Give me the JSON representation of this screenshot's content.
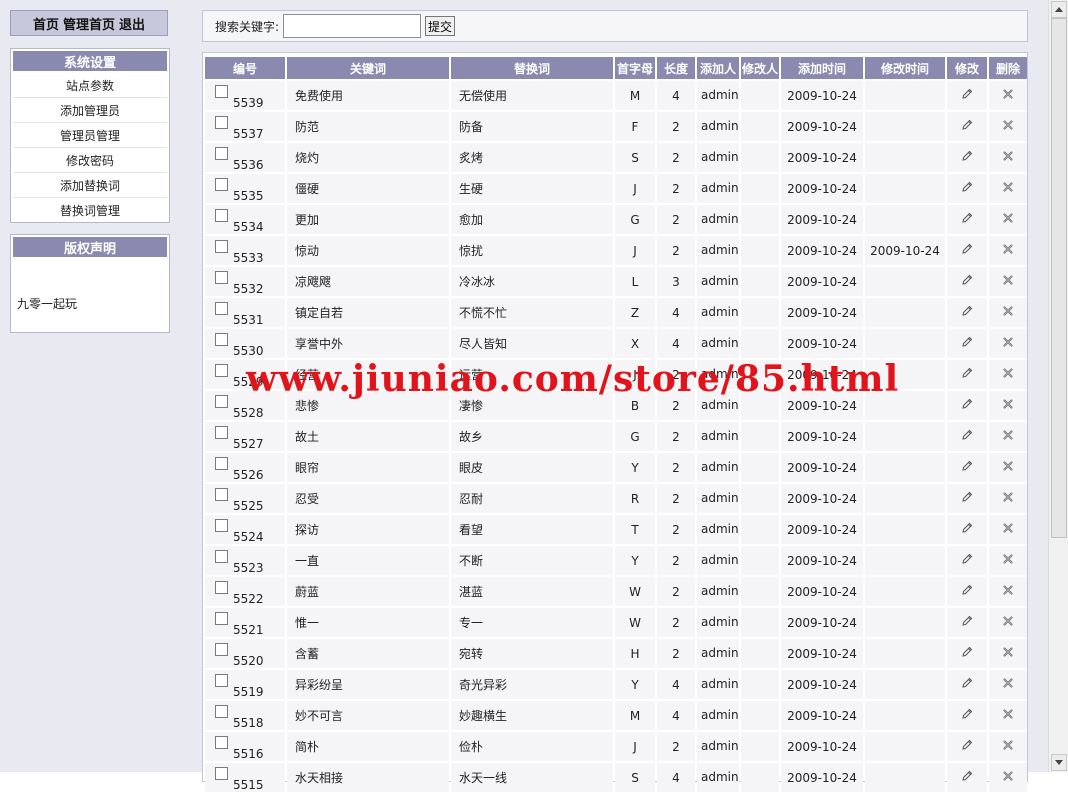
{
  "nav": {
    "home": "首页",
    "admin_home": "管理首页",
    "logout": "退出"
  },
  "settings": {
    "title": "系统设置",
    "items": [
      "站点参数",
      "添加管理员",
      "管理员管理",
      "修改密码",
      "添加替换词",
      "替换词管理"
    ]
  },
  "copyright": {
    "title": "版权声明",
    "text": "九零一起玩"
  },
  "search": {
    "label": "搜索关键字:",
    "value": "",
    "placeholder": "",
    "submit": "提交"
  },
  "table": {
    "headers": [
      "编号",
      "关键词",
      "替换词",
      "首字母",
      "长度",
      "添加人",
      "修改人",
      "添加时间",
      "修改时间",
      "修改",
      "删除"
    ],
    "rows": [
      {
        "id": "5539",
        "keyword": "免费使用",
        "replace": "无偿使用",
        "initial": "M",
        "length": "4",
        "adder": "admin",
        "modifier": "",
        "added": "2009-10-24",
        "modified": ""
      },
      {
        "id": "5537",
        "keyword": "防范",
        "replace": "防备",
        "initial": "F",
        "length": "2",
        "adder": "admin",
        "modifier": "",
        "added": "2009-10-24",
        "modified": ""
      },
      {
        "id": "5536",
        "keyword": "烧灼",
        "replace": "炙烤",
        "initial": "S",
        "length": "2",
        "adder": "admin",
        "modifier": "",
        "added": "2009-10-24",
        "modified": ""
      },
      {
        "id": "5535",
        "keyword": "僵硬",
        "replace": "生硬",
        "initial": "J",
        "length": "2",
        "adder": "admin",
        "modifier": "",
        "added": "2009-10-24",
        "modified": ""
      },
      {
        "id": "5534",
        "keyword": "更加",
        "replace": "愈加",
        "initial": "G",
        "length": "2",
        "adder": "admin",
        "modifier": "",
        "added": "2009-10-24",
        "modified": ""
      },
      {
        "id": "5533",
        "keyword": "惊动",
        "replace": "惊扰",
        "initial": "J",
        "length": "2",
        "adder": "admin",
        "modifier": "",
        "added": "2009-10-24",
        "modified": "2009-10-24"
      },
      {
        "id": "5532",
        "keyword": "凉飕飕",
        "replace": "冷冰冰",
        "initial": "L",
        "length": "3",
        "adder": "admin",
        "modifier": "",
        "added": "2009-10-24",
        "modified": ""
      },
      {
        "id": "5531",
        "keyword": "镇定自若",
        "replace": "不慌不忙",
        "initial": "Z",
        "length": "4",
        "adder": "admin",
        "modifier": "",
        "added": "2009-10-24",
        "modified": ""
      },
      {
        "id": "5530",
        "keyword": "享誉中外",
        "replace": "尽人皆知",
        "initial": "X",
        "length": "4",
        "adder": "admin",
        "modifier": "",
        "added": "2009-10-24",
        "modified": ""
      },
      {
        "id": "5529",
        "keyword": "经营",
        "replace": "运营",
        "initial": "J",
        "length": "2",
        "adder": "admin",
        "modifier": "",
        "added": "2009-10-24",
        "modified": ""
      },
      {
        "id": "5528",
        "keyword": "悲惨",
        "replace": "凄惨",
        "initial": "B",
        "length": "2",
        "adder": "admin",
        "modifier": "",
        "added": "2009-10-24",
        "modified": ""
      },
      {
        "id": "5527",
        "keyword": "故土",
        "replace": "故乡",
        "initial": "G",
        "length": "2",
        "adder": "admin",
        "modifier": "",
        "added": "2009-10-24",
        "modified": ""
      },
      {
        "id": "5526",
        "keyword": "眼帘",
        "replace": "眼皮",
        "initial": "Y",
        "length": "2",
        "adder": "admin",
        "modifier": "",
        "added": "2009-10-24",
        "modified": ""
      },
      {
        "id": "5525",
        "keyword": "忍受",
        "replace": "忍耐",
        "initial": "R",
        "length": "2",
        "adder": "admin",
        "modifier": "",
        "added": "2009-10-24",
        "modified": ""
      },
      {
        "id": "5524",
        "keyword": "探访",
        "replace": "看望",
        "initial": "T",
        "length": "2",
        "adder": "admin",
        "modifier": "",
        "added": "2009-10-24",
        "modified": ""
      },
      {
        "id": "5523",
        "keyword": "一直",
        "replace": "不断",
        "initial": "Y",
        "length": "2",
        "adder": "admin",
        "modifier": "",
        "added": "2009-10-24",
        "modified": ""
      },
      {
        "id": "5522",
        "keyword": "蔚蓝",
        "replace": "湛蓝",
        "initial": "W",
        "length": "2",
        "adder": "admin",
        "modifier": "",
        "added": "2009-10-24",
        "modified": ""
      },
      {
        "id": "5521",
        "keyword": "惟一",
        "replace": "专一",
        "initial": "W",
        "length": "2",
        "adder": "admin",
        "modifier": "",
        "added": "2009-10-24",
        "modified": ""
      },
      {
        "id": "5520",
        "keyword": "含蓄",
        "replace": "宛转",
        "initial": "H",
        "length": "2",
        "adder": "admin",
        "modifier": "",
        "added": "2009-10-24",
        "modified": ""
      },
      {
        "id": "5519",
        "keyword": "异彩纷呈",
        "replace": "奇光异彩",
        "initial": "Y",
        "length": "4",
        "adder": "admin",
        "modifier": "",
        "added": "2009-10-24",
        "modified": ""
      },
      {
        "id": "5518",
        "keyword": "妙不可言",
        "replace": "妙趣横生",
        "initial": "M",
        "length": "4",
        "adder": "admin",
        "modifier": "",
        "added": "2009-10-24",
        "modified": ""
      },
      {
        "id": "5516",
        "keyword": "简朴",
        "replace": "俭朴",
        "initial": "J",
        "length": "2",
        "adder": "admin",
        "modifier": "",
        "added": "2009-10-24",
        "modified": ""
      },
      {
        "id": "5515",
        "keyword": "水天相接",
        "replace": "水天一线",
        "initial": "S",
        "length": "4",
        "adder": "admin",
        "modifier": "",
        "added": "2009-10-24",
        "modified": ""
      }
    ]
  },
  "watermark": "www.jiuniao.com/store/85.html",
  "icons": {
    "edit": "pencil-icon",
    "delete": "delete-x-icon"
  },
  "colors": {
    "header_bg": "#8a8ab0",
    "page_bg": "#e9e9f1",
    "watermark": "#e1141c"
  }
}
